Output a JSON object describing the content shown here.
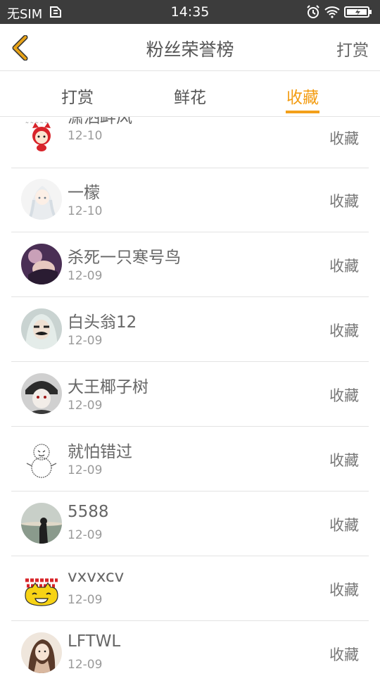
{
  "status_bar": {
    "carrier": "无SIM",
    "time": "14:35",
    "icons": [
      "sim-icon",
      "alarm-icon",
      "wifi-icon",
      "battery-icon"
    ]
  },
  "header": {
    "title": "粉丝荣誉榜",
    "right_action": "打赏",
    "back_icon": "chevron-left-icon"
  },
  "tabs": [
    {
      "label": "打赏",
      "active": false
    },
    {
      "label": "鲜花",
      "active": false
    },
    {
      "label": "收藏",
      "active": true
    }
  ],
  "colors": {
    "accent": "#f39c12",
    "back_arrow": "#e8a317",
    "status_bar": "#3c3c3c"
  },
  "fans": [
    {
      "name": "潇洒衅风",
      "date": "12-10",
      "action": "收藏"
    },
    {
      "name": "一檬",
      "date": "12-10",
      "action": "收藏"
    },
    {
      "name": "杀死一只寒号鸟",
      "date": "12-09",
      "action": "收藏"
    },
    {
      "name": "白头翁12",
      "date": "12-09",
      "action": "收藏"
    },
    {
      "name": "大王椰子树",
      "date": "12-09",
      "action": "收藏"
    },
    {
      "name": "就怕错过",
      "date": "12-09",
      "action": "收藏"
    },
    {
      "name": "5588",
      "date": "12-09",
      "action": "收藏"
    },
    {
      "name": "vxvxcv",
      "date": "12-09",
      "action": "收藏"
    },
    {
      "name": "LFTWL",
      "date": "12-09",
      "action": "收藏"
    }
  ]
}
